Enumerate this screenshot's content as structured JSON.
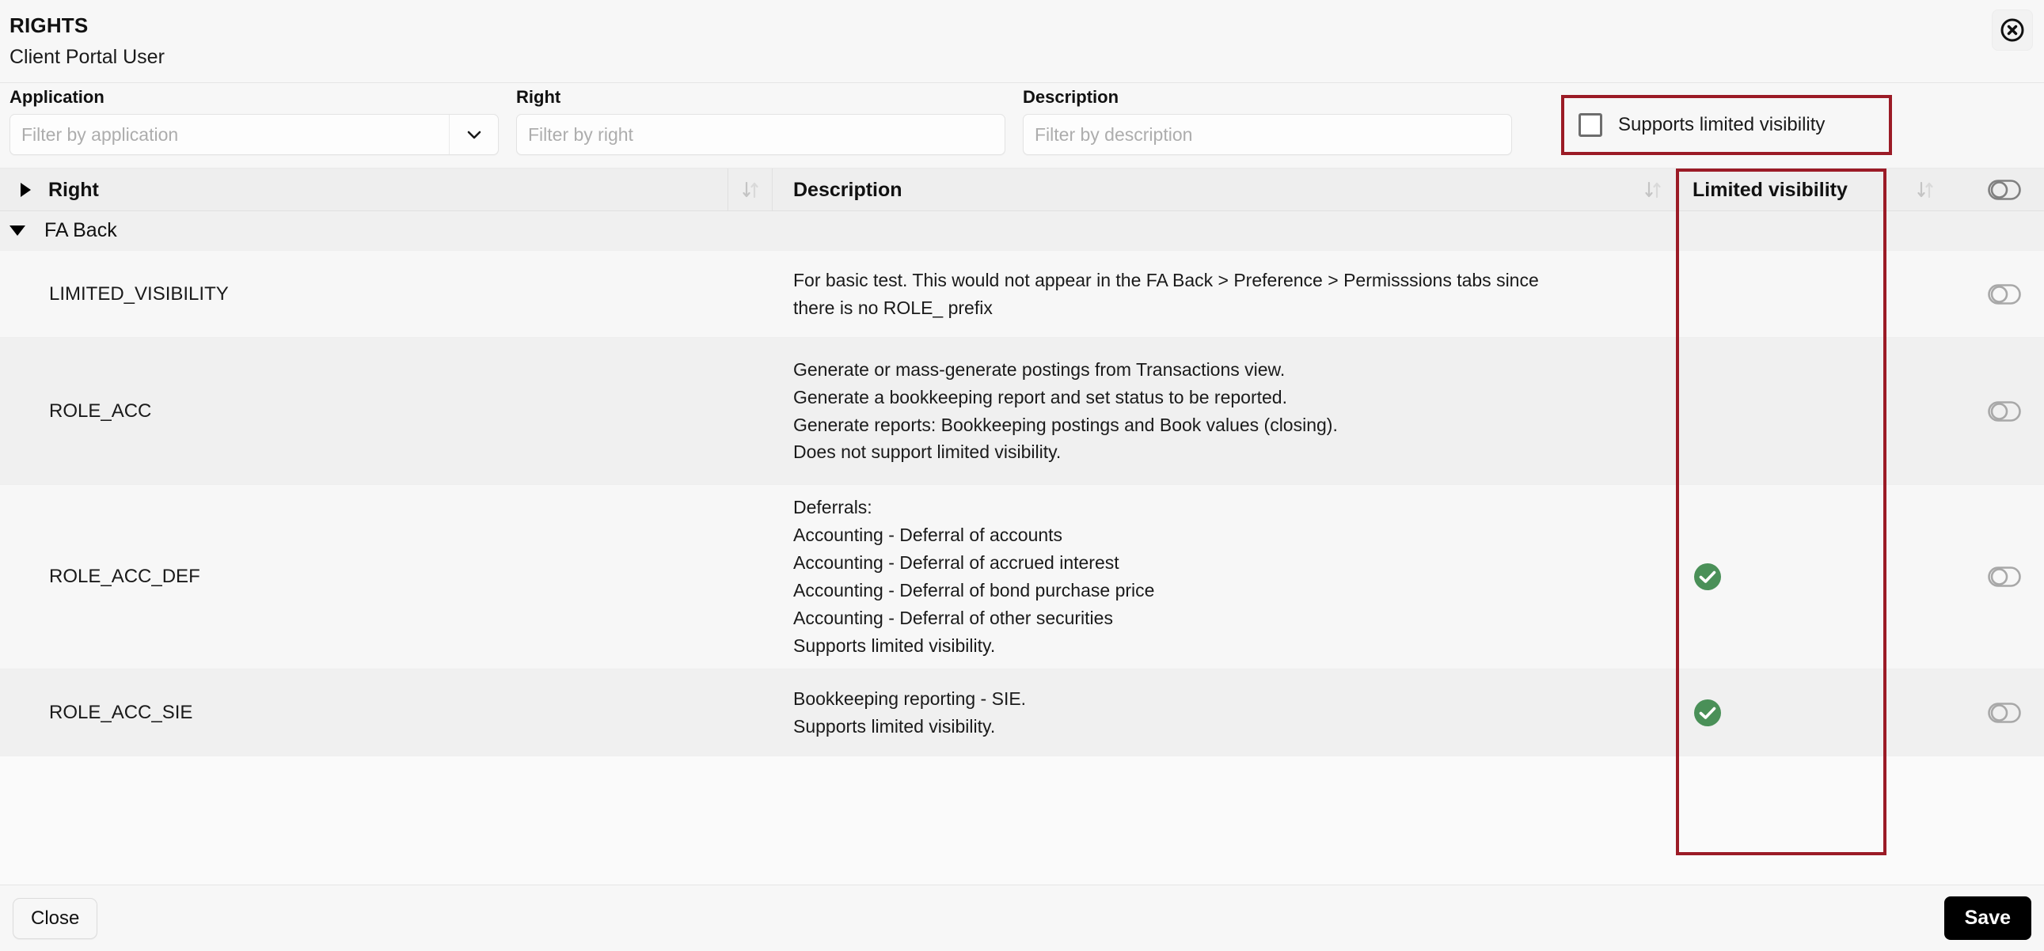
{
  "dialog": {
    "title": "RIGHTS",
    "subtitle": "Client Portal User",
    "close_icon": "circle-x-icon"
  },
  "filters": {
    "application": {
      "label": "Application",
      "placeholder": "Filter by application",
      "value": "",
      "dropdown_icon": "chevron-down-icon"
    },
    "right": {
      "label": "Right",
      "placeholder": "Filter by right",
      "value": ""
    },
    "description": {
      "label": "Description",
      "placeholder": "Filter by description",
      "value": ""
    },
    "supports_limited_visibility": {
      "label": "Supports limited visibility",
      "checked": false,
      "highlight_color": "#9b1b26"
    }
  },
  "table": {
    "columns": {
      "right": "Right",
      "description": "Description",
      "limited_visibility": "Limited visibility"
    },
    "sort_icon": "sort-updown-icon",
    "column_settings_icon": "toggle-switch-icon",
    "expand_all_icon": "caret-right-icon",
    "group": {
      "label": "FA Back",
      "collapse_icon": "caret-down-icon",
      "expanded": true
    },
    "highlight_color": "#9b1b26",
    "check_icon": "check-circle-icon",
    "check_color": "#4a9058",
    "row_toggle_icon": "toggle-switch-icon",
    "rows": [
      {
        "right": "LIMITED_VISIBILITY",
        "description": "For basic test. This would not appear in the FA Back > Preference > Permisssions tabs since\nthere is no ROLE_ prefix",
        "limited_visibility": false
      },
      {
        "right": "ROLE_ACC",
        "description": "Generate or mass-generate postings from Transactions view.\nGenerate a bookkeeping report and set status to be reported.\nGenerate reports: Bookkeeping postings and Book values (closing).\nDoes not support limited visibility.",
        "limited_visibility": false
      },
      {
        "right": "ROLE_ACC_DEF",
        "description": "Deferrals:\nAccounting - Deferral of accounts\nAccounting - Deferral of accrued interest\nAccounting - Deferral of bond purchase price\nAccounting - Deferral of other securities\nSupports limited visibility.",
        "limited_visibility": true
      },
      {
        "right": "ROLE_ACC_SIE",
        "description": "Bookkeeping reporting - SIE.\nSupports limited visibility.",
        "limited_visibility": true
      }
    ]
  },
  "footer": {
    "close_label": "Close",
    "save_label": "Save"
  }
}
